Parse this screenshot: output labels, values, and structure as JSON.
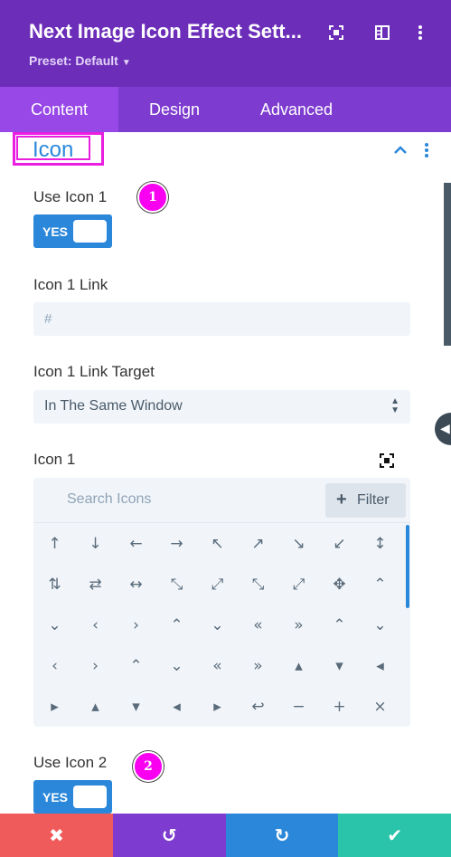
{
  "header": {
    "title": "Next Image Icon Effect Sett...",
    "preset": "Preset: Default",
    "icons": [
      "fullscreen-icon",
      "split-view-icon",
      "more-vertical-icon"
    ]
  },
  "tabs": [
    {
      "label": "Content",
      "active": true
    },
    {
      "label": "Design",
      "active": false
    },
    {
      "label": "Advanced",
      "active": false
    }
  ],
  "section": {
    "title": "Icon"
  },
  "fields": {
    "use_icon_1": {
      "label": "Use Icon 1",
      "toggle": "YES",
      "badge": "1"
    },
    "icon_1_link": {
      "label": "Icon 1 Link",
      "placeholder": "#"
    },
    "icon_1_link_target": {
      "label": "Icon 1 Link Target",
      "value": "In The Same Window"
    },
    "icon_1": {
      "label": "Icon 1",
      "search_placeholder": "Search Icons",
      "filter_label": "Filter",
      "filter_icon": "+",
      "icons": [
        "↑",
        "↓",
        "←",
        "→",
        "↖",
        "↗",
        "↘",
        "↙",
        "↕",
        "⇅",
        "⇄",
        "↔",
        "⤡",
        "⤢",
        "⤡",
        "⤢",
        "✥",
        "⌃",
        "⌄",
        "‹",
        "›",
        "⌃",
        "⌄",
        "«",
        "»",
        "⌃",
        "⌄",
        "‹",
        "›",
        "⌃",
        "⌄",
        "«",
        "»",
        "▴",
        "▾",
        "◂",
        "▸",
        "▴",
        "▾",
        "◂",
        "▸",
        "↩",
        "−",
        "+",
        "×"
      ]
    },
    "use_icon_2": {
      "label": "Use Icon 2",
      "toggle": "YES",
      "badge": "2"
    }
  },
  "footer": {
    "buttons": [
      {
        "name": "cancel",
        "glyph": "✖",
        "color": "#ef5a5a"
      },
      {
        "name": "undo",
        "glyph": "↺",
        "color": "#7d3bcf"
      },
      {
        "name": "redo",
        "glyph": "↻",
        "color": "#2b87da"
      },
      {
        "name": "save",
        "glyph": "✔",
        "color": "#29c4a9"
      }
    ]
  },
  "colors": {
    "header": "#6c2eb9",
    "tabs": "#7d3bcf",
    "accent": "#2b87da",
    "highlight": "#e91ee0"
  }
}
